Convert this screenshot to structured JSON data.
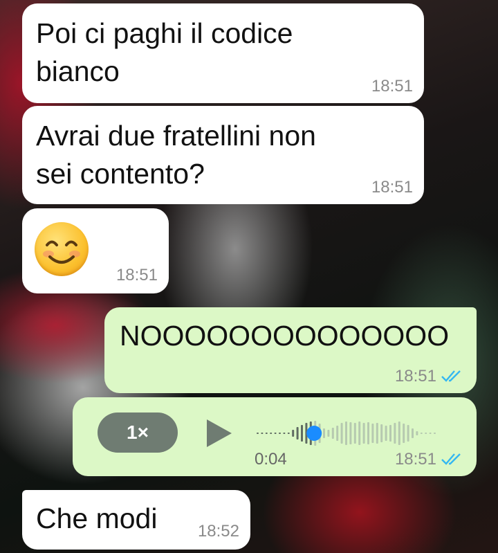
{
  "messages": [
    {
      "text": "Poi ci paghi il codice\nbianco",
      "time": "18:51",
      "direction": "incoming"
    },
    {
      "text": "Avrai due fratellini non\nsei contento?",
      "time": "18:51",
      "direction": "incoming"
    },
    {
      "emoji": "smiling-face",
      "time": "18:51",
      "direction": "incoming"
    },
    {
      "text": "NOOOOOOOOOOOOOO",
      "time": "18:51",
      "direction": "outgoing",
      "status": "read"
    },
    {
      "voice": {
        "speed": "1×",
        "duration": "0:04",
        "progress": 0.31
      },
      "time": "18:51",
      "direction": "outgoing",
      "status": "read"
    },
    {
      "text": "Che modi",
      "time": "18:52",
      "direction": "incoming"
    }
  ],
  "colors": {
    "incoming_bubble": "#ffffff",
    "outgoing_bubble": "#dcf8c6",
    "read_ticks": "#34b7f1",
    "voice_dot": "#1a8cff"
  }
}
